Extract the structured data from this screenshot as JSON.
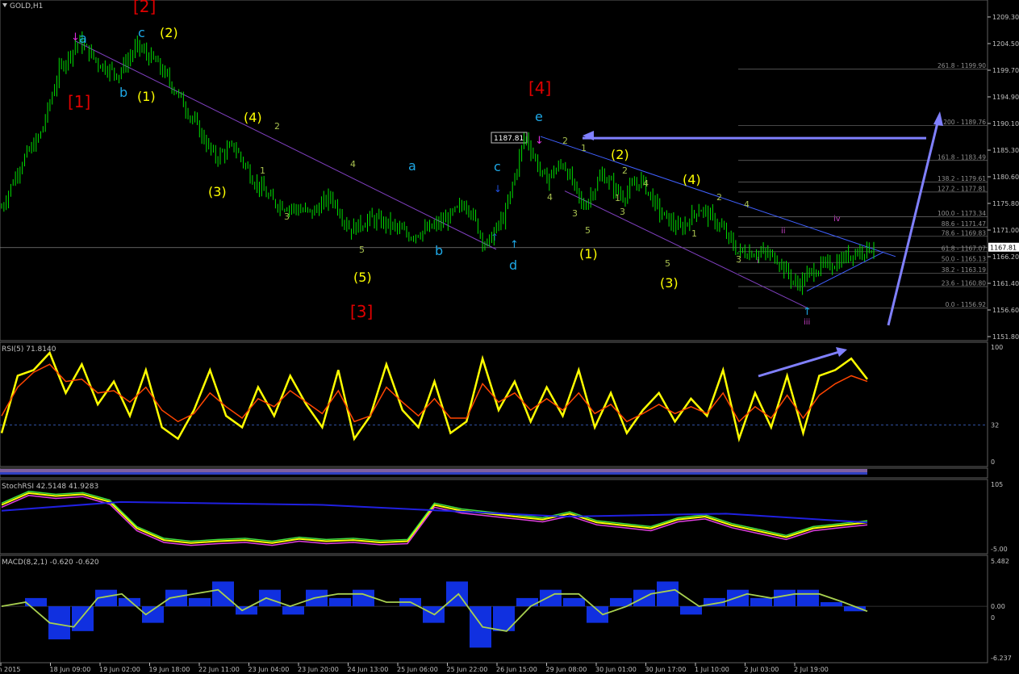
{
  "chart_title": "GOLD,H1",
  "colors": {
    "background": "#000000",
    "candle": "#00e000",
    "axis": "#c0c0c0",
    "grid_text": "#c0c0c0",
    "rsi_line": "#ffff00",
    "rsi_signal": "#ff4500",
    "wave_red": "#e00000",
    "wave_cyan": "#1ea8e6",
    "wave_yellow": "#ffff00",
    "wave_olive": "#a8c050",
    "wave_magenta": "#c040c0",
    "annotation_arrow": "#8080ff",
    "trendline": "#4060ff",
    "macd_hist": "#1030e0",
    "macd_signal": "#a8d050"
  },
  "price_axis": {
    "ticks": [
      "1209.30",
      "1204.50",
      "1199.70",
      "1194.90",
      "1190.10",
      "1185.30",
      "1180.60",
      "1175.80",
      "1171.00",
      "1166.20",
      "1161.40",
      "1156.60",
      "1151.80"
    ],
    "current_price": "1167.81"
  },
  "fib_levels": [
    {
      "label": "261.8 - 1199.90"
    },
    {
      "label": "200 - 1189.76"
    },
    {
      "label": "161.8 - 1183.49"
    },
    {
      "label": "138.2 - 1179.61"
    },
    {
      "label": "127.2 - 1177.81"
    },
    {
      "label": "100.0 - 1173.34"
    },
    {
      "label": "88.6 - 1171.47"
    },
    {
      "label": "78.6 - 1169.83"
    },
    {
      "label": "61.8 - 1167.07"
    },
    {
      "label": "50.0 - 1165.13"
    },
    {
      "label": "38.2 - 1163.19"
    },
    {
      "label": "23.6 - 1160.80"
    },
    {
      "label": "0.0 - 1156.92"
    }
  ],
  "price_box_label": "1187.81",
  "wave_labels": {
    "red": [
      "[2]",
      "[1]",
      "[4]",
      "[3]"
    ],
    "cyan": [
      "a",
      "c",
      "b",
      "e",
      "a",
      "c",
      "b",
      "d"
    ],
    "yellow": [
      "(2)",
      "(1)",
      "(4)",
      "(3)",
      "(5)",
      "(2)",
      "(4)",
      "(1)",
      "(3)"
    ],
    "olive": [
      "2",
      "1",
      "4",
      "3",
      "5",
      "2",
      "4",
      "1",
      "3",
      "5",
      "2",
      "4",
      "1",
      "3",
      "5",
      "2",
      "4",
      "1",
      "3"
    ],
    "magenta": [
      "i",
      "ii",
      "iii",
      "iv"
    ]
  },
  "time_axis": [
    "Jun 2015",
    "18 Jun 09:00",
    "19 Jun 02:00",
    "19 Jun 18:00",
    "22 Jun 11:00",
    "23 Jun 04:00",
    "23 Jun 20:00",
    "24 Jun 13:00",
    "25 Jun 06:00",
    "25 Jun 22:00",
    "26 Jun 15:00",
    "29 Jun 08:00",
    "30 Jun 01:00",
    "30 Jun 17:00",
    "1 Jul 10:00",
    "2 Jul 03:00",
    "2 Jul 19:00"
  ],
  "rsi": {
    "label": "RSI(5) 71.8140",
    "ticks": [
      "100",
      "32",
      "0"
    ]
  },
  "stochrsi": {
    "label": "StochRSI 42.5148 41.9283",
    "ticks": [
      "105",
      "-5.00"
    ]
  },
  "macd": {
    "label": "MACD(8,2,1) -0.620 -0.620",
    "ticks": [
      "5.482",
      "0.00",
      "0",
      "-6.237"
    ]
  },
  "chart_data": [
    {
      "type": "candlestick",
      "title": "GOLD,H1",
      "ylim": [
        1151.8,
        1211.0
      ],
      "x": [
        "Jun 2015",
        "18 Jun 09:00",
        "19 Jun 02:00",
        "19 Jun 18:00",
        "22 Jun 11:00",
        "23 Jun 04:00",
        "23 Jun 20:00",
        "24 Jun 13:00",
        "25 Jun 06:00",
        "25 Jun 22:00",
        "26 Jun 15:00",
        "29 Jun 08:00",
        "30 Jun 01:00",
        "30 Jun 17:00",
        "1 Jul 10:00",
        "2 Jul 03:00",
        "2 Jul 19:00"
      ],
      "close_path": [
        1175,
        1183,
        1188,
        1200,
        1205,
        1201,
        1199,
        1204,
        1201,
        1196,
        1190,
        1184,
        1186,
        1180,
        1176,
        1175,
        1174,
        1177,
        1171,
        1173,
        1172,
        1170,
        1171,
        1173,
        1176,
        1168,
        1174,
        1188,
        1180,
        1183,
        1175,
        1181,
        1177,
        1180,
        1174,
        1171,
        1175,
        1172,
        1167,
        1167,
        1166,
        1161,
        1164,
        1165,
        1167,
        1168
      ]
    },
    {
      "type": "line",
      "title": "RSI(5) 71.8140",
      "ylim": [
        0,
        100
      ],
      "series": [
        {
          "name": "RSI(5)",
          "values": [
            25,
            75,
            80,
            95,
            60,
            85,
            50,
            70,
            40,
            80,
            30,
            20,
            45,
            80,
            40,
            30,
            65,
            40,
            75,
            50,
            30,
            80,
            20,
            40,
            85,
            45,
            30,
            70,
            25,
            35,
            90,
            45,
            70,
            35,
            65,
            40,
            80,
            30,
            60,
            25,
            45,
            60,
            35,
            55,
            40,
            80,
            20,
            60,
            30,
            75,
            25,
            75,
            80,
            90,
            72
          ]
        },
        {
          "name": "Signal",
          "values": [
            40,
            65,
            78,
            85,
            70,
            72,
            60,
            62,
            52,
            65,
            45,
            35,
            42,
            60,
            48,
            38,
            55,
            48,
            62,
            52,
            42,
            62,
            35,
            40,
            65,
            52,
            40,
            55,
            38,
            38,
            68,
            52,
            60,
            45,
            55,
            45,
            60,
            42,
            50,
            35,
            42,
            50,
            42,
            48,
            42,
            60,
            35,
            48,
            38,
            58,
            38,
            58,
            68,
            75,
            70
          ]
        }
      ],
      "reference_line": 32
    },
    {
      "type": "line",
      "title": "StochRSI 42.5148 41.9283",
      "ylim": [
        -5,
        105
      ],
      "series": [
        {
          "name": "StochRSI",
          "values": [
            70,
            90,
            85,
            88,
            75,
            30,
            10,
            5,
            8,
            10,
            5,
            12,
            8,
            10,
            6,
            8,
            70,
            60,
            55,
            50,
            45,
            55,
            40,
            35,
            30,
            45,
            50,
            35,
            25,
            15,
            30,
            35,
            40
          ]
        }
      ]
    },
    {
      "type": "bar",
      "title": "MACD(8,2,1) -0.620 -0.620",
      "ylim": [
        -6.237,
        5.482
      ],
      "series": [
        {
          "name": "MACD histogram",
          "values": [
            0,
            1,
            -4,
            -3,
            2,
            1,
            -2,
            2,
            1,
            3,
            -1,
            2,
            -1,
            2,
            1,
            2,
            0,
            1,
            -2,
            3,
            -5,
            -3,
            1,
            2,
            1,
            -2,
            1,
            2,
            3,
            -1,
            1,
            2,
            1,
            2,
            2,
            0.5,
            -0.6
          ]
        },
        {
          "name": "Signal",
          "values": [
            0,
            0.5,
            -2,
            -2.5,
            1,
            1.5,
            -1,
            1,
            1.5,
            2,
            -0.5,
            1,
            0,
            1,
            1.5,
            1.5,
            0.5,
            0.5,
            -1,
            1.5,
            -2.5,
            -3,
            0,
            1.5,
            1.5,
            -1,
            0,
            1.5,
            2,
            0,
            0.5,
            1.5,
            1,
            1.5,
            1.5,
            0.5,
            -0.6
          ]
        }
      ],
      "reference_line": 0
    }
  ]
}
